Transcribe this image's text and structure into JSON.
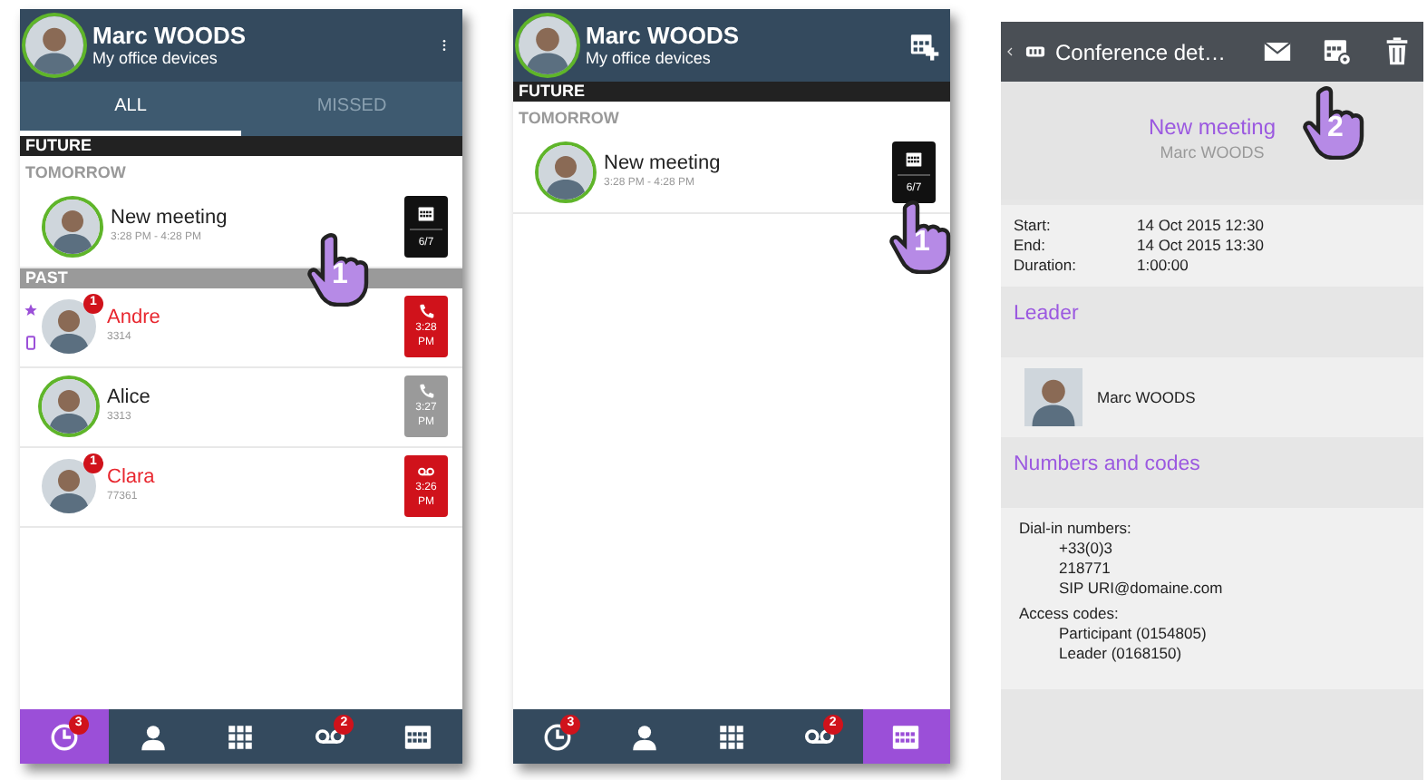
{
  "screens": [
    {
      "kind": "list",
      "header": {
        "name": "Marc WOODS",
        "subtitle": "My office devices",
        "online": true,
        "action": {
          "kind": "menu"
        }
      },
      "tabs": [
        {
          "label": "ALL",
          "selected": true
        },
        {
          "label": "MISSED",
          "selected": false
        }
      ],
      "rows": [
        {
          "kind": "section",
          "dark": true,
          "label": "FUTURE"
        },
        {
          "kind": "subsection",
          "label": "TOMORROW"
        },
        {
          "kind": "meeting",
          "title": "New meeting",
          "time": "3:28 PM - 4:28 PM",
          "date": "6/7",
          "online": true
        },
        {
          "kind": "section",
          "dark": false,
          "label": "PAST"
        },
        {
          "kind": "call",
          "name": "Andre",
          "number": "3314",
          "missed": true,
          "unread": "1",
          "favorite": true,
          "mobile": true,
          "online": false,
          "voicemail": false,
          "time": "3:28",
          "period": "PM"
        },
        {
          "kind": "call",
          "name": "Alice",
          "number": "3313",
          "missed": false,
          "favorite": false,
          "mobile": false,
          "online": true,
          "voicemail": false,
          "time": "3:27",
          "period": "PM"
        },
        {
          "kind": "call",
          "name": "Clara",
          "number": "77361",
          "missed": true,
          "unread": "1",
          "favorite": false,
          "mobile": false,
          "online": false,
          "voicemail": true,
          "time": "3:26",
          "period": "PM"
        }
      ],
      "nav": [
        {
          "kind": "history",
          "badge": "3",
          "selected": true
        },
        {
          "kind": "contacts",
          "selected": false
        },
        {
          "kind": "dialpad",
          "selected": false
        },
        {
          "kind": "voicemail",
          "badge": "2",
          "selected": false
        },
        {
          "kind": "calendar",
          "selected": false
        }
      ],
      "pointer": {
        "step": "1"
      }
    },
    {
      "kind": "list",
      "header": {
        "name": "Marc WOODS",
        "subtitle": "My office devices",
        "online": true,
        "action": {
          "kind": "calendar-add"
        }
      },
      "rows": [
        {
          "kind": "section",
          "dark": true,
          "label": "FUTURE"
        },
        {
          "kind": "subsection",
          "label": "TOMORROW"
        },
        {
          "kind": "meeting",
          "title": "New meeting",
          "time": "3:28 PM - 4:28 PM",
          "date": "6/7",
          "online": true
        }
      ],
      "nav": [
        {
          "kind": "history",
          "badge": "3",
          "selected": false
        },
        {
          "kind": "contacts",
          "selected": false
        },
        {
          "kind": "dialpad",
          "selected": false
        },
        {
          "kind": "voicemail",
          "badge": "2",
          "selected": false
        },
        {
          "kind": "calendar",
          "selected": true
        }
      ],
      "pointer": {
        "step": "1"
      }
    },
    {
      "kind": "detail",
      "topbar": {
        "title": "Conference det…",
        "actions": [
          {
            "kind": "mail"
          },
          {
            "kind": "calendar-settings"
          },
          {
            "kind": "delete"
          }
        ]
      },
      "title": "New meeting",
      "organizer": "Marc WOODS",
      "details": [
        {
          "label": "Start:",
          "value": "14 Oct 2015 12:30"
        },
        {
          "label": "End:",
          "value": "14 Oct 2015 13:30"
        },
        {
          "label": "Duration:",
          "value": "1:00:00"
        }
      ],
      "leader": {
        "heading": "Leader",
        "name": "Marc WOODS"
      },
      "numbers": {
        "heading": "Numbers and codes",
        "groups": [
          {
            "label": "Dial-in numbers:",
            "lines": [
              "+33(0)3",
              "218771",
              "SIP URI@domaine.com"
            ]
          },
          {
            "label": "Access codes:",
            "lines": [
              "Participant (0154805)",
              "Leader (0168150)"
            ]
          }
        ]
      },
      "pointer": {
        "step": "2"
      }
    }
  ]
}
